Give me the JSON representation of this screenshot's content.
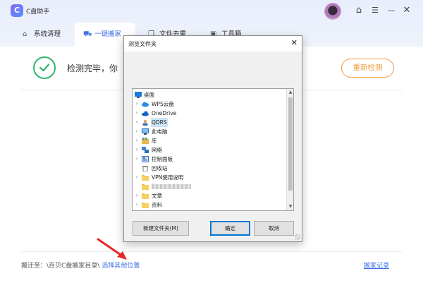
{
  "app": {
    "title": "C盘助手",
    "logo_glyph": "C",
    "accent_color": "#3d6fe6"
  },
  "window_controls": {
    "home_icon": "⌂",
    "menu_icon": "☰",
    "minimize_icon": "—",
    "close_icon": "✕"
  },
  "tabs": [
    {
      "label": "系统清理",
      "icon": "home-icon",
      "glyph": "⌂",
      "active": false
    },
    {
      "label": "一键搬家",
      "icon": "truck-icon",
      "glyph": "⛟",
      "active": true
    },
    {
      "label": "文件去重",
      "icon": "copy-icon",
      "glyph": "❐",
      "active": false
    },
    {
      "label": "工具箱",
      "icon": "toolbox-icon",
      "glyph": "▣",
      "active": false
    }
  ],
  "main": {
    "status_text": "检测完毕，你",
    "rescan_label": "重新检测",
    "status_color": "#2fb56c",
    "rescan_color": "#f29a3c"
  },
  "bottom": {
    "move_to_label": "搬迁至：\\百贝C盘搬家目录\\",
    "choose_location_link": "选择其他位置",
    "move_record_link": "搬家记录"
  },
  "dialog": {
    "title": "浏览文件夹",
    "close_icon": "✕",
    "tree": [
      {
        "label": "桌面",
        "icon": "desktop-icon",
        "expandable": false,
        "level": 0
      },
      {
        "label": "WPS云盘",
        "icon": "cloud-icon",
        "expandable": true,
        "level": 1
      },
      {
        "label": "OneDrive",
        "icon": "onedrive-icon",
        "expandable": true,
        "level": 1
      },
      {
        "label": "QDRS",
        "icon": "user-icon",
        "expandable": true,
        "level": 1,
        "selected": true
      },
      {
        "label": "此电脑",
        "icon": "computer-icon",
        "expandable": true,
        "level": 1
      },
      {
        "label": "库",
        "icon": "library-icon",
        "expandable": true,
        "level": 1
      },
      {
        "label": "网络",
        "icon": "network-icon",
        "expandable": true,
        "level": 1
      },
      {
        "label": "控制面板",
        "icon": "control-panel-icon",
        "expandable": true,
        "level": 1
      },
      {
        "label": "回收站",
        "icon": "recycle-bin-icon",
        "expandable": false,
        "level": 1
      },
      {
        "label": "VPN使用说明",
        "icon": "folder-icon",
        "expandable": true,
        "level": 1
      },
      {
        "label": "",
        "icon": "folder-icon",
        "expandable": false,
        "level": 1,
        "blurred": true
      },
      {
        "label": "文章",
        "icon": "folder-icon",
        "expandable": true,
        "level": 1
      },
      {
        "label": "资料",
        "icon": "folder-icon",
        "expandable": true,
        "level": 1
      }
    ],
    "new_folder_label": "新建文件夹(M)",
    "ok_label": "确定",
    "cancel_label": "取消"
  }
}
